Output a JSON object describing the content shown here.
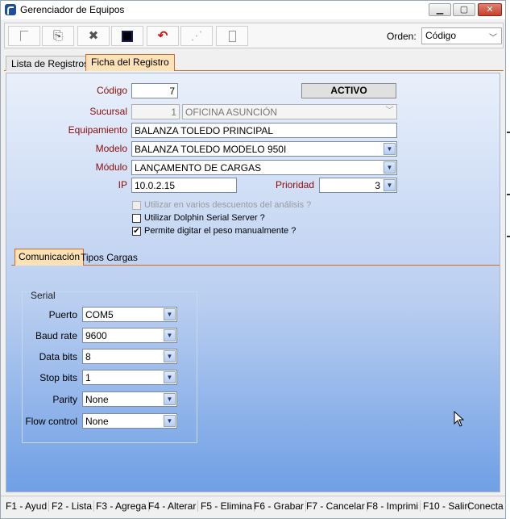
{
  "window": {
    "title": "Gerenciador de Equipos",
    "minimize": "▁",
    "maximize": "▢",
    "close": "✕"
  },
  "toolbar": {
    "orden_label": "Orden:",
    "orden_value": "Código",
    "icons": [
      "new-icon",
      "copy-icon",
      "delete-icon",
      "save-icon",
      "undo-icon",
      "refresh-icon",
      "report-icon"
    ]
  },
  "tabs": [
    "Lista de Registros",
    "Ficha del Registro"
  ],
  "form": {
    "codigo_label": "Código",
    "codigo_value": "7",
    "status": "ACTIVO",
    "sucursal_label": "Sucursal",
    "sucursal_code": "1",
    "sucursal_name": "OFICINA ASUNCIÓN",
    "equipamiento_label": "Equipamiento",
    "equipamiento_value": "BALANZA TOLEDO PRINCIPAL",
    "modelo_label": "Modelo",
    "modelo_value": "BALANZA TOLEDO MODELO 950I",
    "modulo_label": "Módulo",
    "modulo_value": "LANÇAMENTO DE CARGAS",
    "ip_label": "IP",
    "ip_value": "10.0.2.15",
    "prioridad_label": "Prioridad",
    "prioridad_value": "3",
    "chk_descuentos": "Utilizar en varios descuentos del análisis ?",
    "chk_dolphin": "Utilizar Dolphin Serial Server ?",
    "chk_peso": "Permite digitar el peso manualmente ?",
    "chk_peso_mark": "✔"
  },
  "subtabs": [
    "Comunicación",
    "Tipos Cargas"
  ],
  "serial": {
    "title": "Serial",
    "puerto_label": "Puerto",
    "puerto_value": "COM5",
    "baud_label": "Baud rate",
    "baud_value": "9600",
    "databits_label": "Data bits",
    "databits_value": "8",
    "stopbits_label": "Stop bits",
    "stopbits_value": "1",
    "parity_label": "Parity",
    "parity_value": "None",
    "flow_label": "Flow control",
    "flow_value": "None"
  },
  "fkeys": [
    "F1 - Ayud",
    "F2 - Lista",
    "F3 - Agrega",
    "F4 - Alterar",
    "F5 - Elimina",
    "F6 - Grabar",
    "F7 - Cancelar",
    "F8 - Imprimi",
    "F10 - Salir",
    "Conecta"
  ],
  "colors": {
    "accent": "#d06a2a",
    "label": "#8a0b0b",
    "panel_bottom": "#6f9fe5"
  }
}
